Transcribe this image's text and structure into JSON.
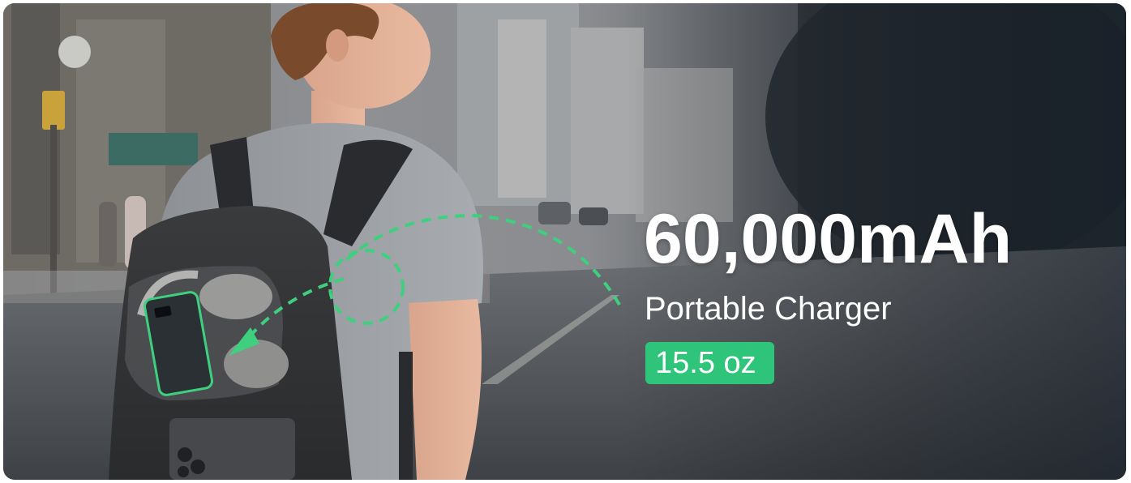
{
  "promo": {
    "capacity": "60,000mAh",
    "product": "Portable Charger",
    "weight": "15.5 oz"
  },
  "colors": {
    "accent_green": "#2ec47a",
    "dash_green": "#3fd07f",
    "text": "#ffffff"
  },
  "icons": [
    "dashed-arrow-icon",
    "dashed-circle-icon",
    "power-bank-icon",
    "headphones-icon",
    "phone-icon"
  ]
}
